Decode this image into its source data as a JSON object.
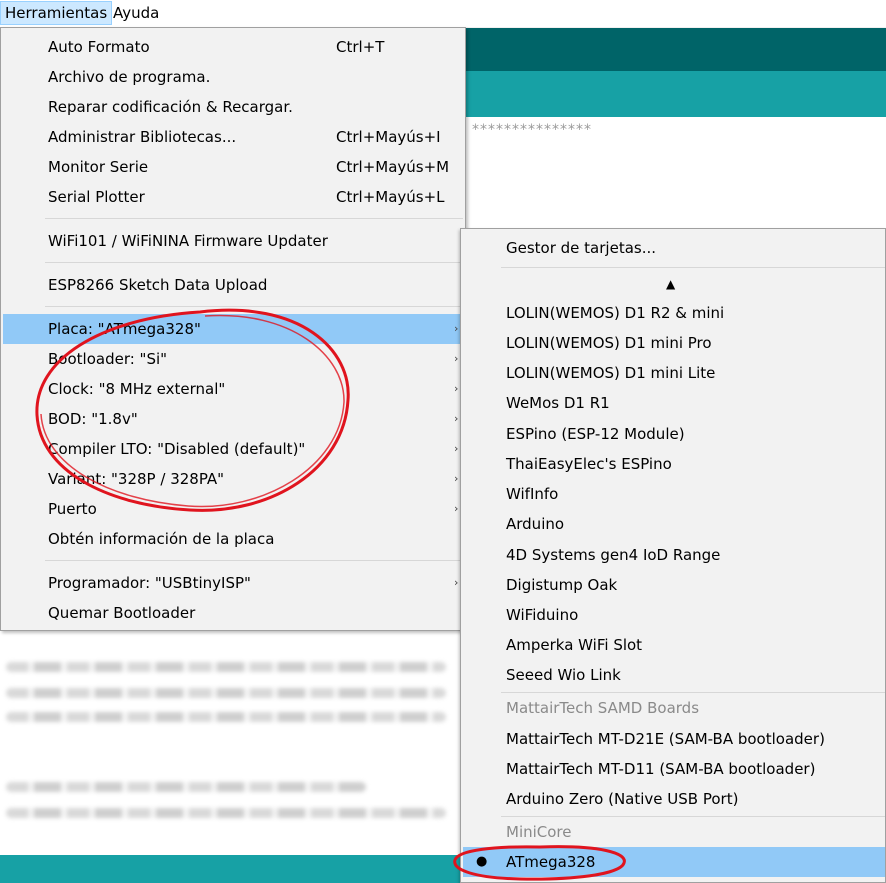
{
  "menubar": {
    "items": [
      {
        "label": "Herramientas"
      },
      {
        "label": "Ayuda"
      }
    ]
  },
  "background": {
    "stars": "***************"
  },
  "tools_menu": {
    "items": [
      {
        "label": "Auto Formato",
        "shortcut": "Ctrl+T"
      },
      {
        "label": "Archivo de programa.",
        "shortcut": ""
      },
      {
        "label": "Reparar codificación & Recargar.",
        "shortcut": ""
      },
      {
        "label": "Administrar Bibliotecas...",
        "shortcut": "Ctrl+Mayús+I"
      },
      {
        "label": "Monitor Serie",
        "shortcut": "Ctrl+Mayús+M"
      },
      {
        "label": "Serial Plotter",
        "shortcut": "Ctrl+Mayús+L"
      },
      {
        "label": "WiFi101 / WiFiNINA Firmware Updater",
        "shortcut": ""
      },
      {
        "label": "ESP8266 Sketch Data Upload",
        "shortcut": ""
      },
      {
        "label": "Placa: \"ATmega328\"",
        "shortcut": "",
        "submenu": true
      },
      {
        "label": "Bootloader: \"Si\"",
        "shortcut": "",
        "submenu": true
      },
      {
        "label": "Clock: \"8 MHz external\"",
        "shortcut": "",
        "submenu": true
      },
      {
        "label": "BOD: \"1.8v\"",
        "shortcut": "",
        "submenu": true
      },
      {
        "label": "Compiler LTO: \"Disabled (default)\"",
        "shortcut": "",
        "submenu": true
      },
      {
        "label": "Variant: \"328P / 328PA\"",
        "shortcut": "",
        "submenu": true
      },
      {
        "label": "Puerto",
        "shortcut": "",
        "submenu": true
      },
      {
        "label": "Obtén información de la placa",
        "shortcut": ""
      },
      {
        "label": "Programador: \"USBtinyISP\"",
        "shortcut": "",
        "submenu": true
      },
      {
        "label": "Quemar Bootloader",
        "shortcut": ""
      }
    ],
    "submenu_arrow": "›"
  },
  "board_submenu": {
    "manager": "Gestor de tarjetas...",
    "scroll_up_glyph": "▲",
    "boards": [
      "LOLIN(WEMOS) D1 R2 & mini",
      "LOLIN(WEMOS) D1 mini Pro",
      "LOLIN(WEMOS) D1 mini Lite",
      "WeMos D1 R1",
      "ESPino (ESP-12 Module)",
      "ThaiEasyElec's ESPino",
      "WifInfo",
      "Arduino",
      "4D Systems gen4 IoD Range",
      "Digistump Oak",
      "WiFiduino",
      "Amperka WiFi Slot",
      "Seeed Wio Link"
    ],
    "group_mattair": "MattairTech SAMD Boards",
    "mattair_boards": [
      "MattairTech MT-D21E (SAM-BA bootloader)",
      "MattairTech MT-D11 (SAM-BA bootloader)",
      "Arduino Zero (Native USB Port)"
    ],
    "group_minicore": "MiniCore",
    "selected_board": "ATmega328",
    "selected_bullet": "●"
  },
  "colors": {
    "highlight": "#91c9f7",
    "annotation": "#e0141e",
    "teal_dark": "#006468",
    "teal": "#17a1a5"
  }
}
